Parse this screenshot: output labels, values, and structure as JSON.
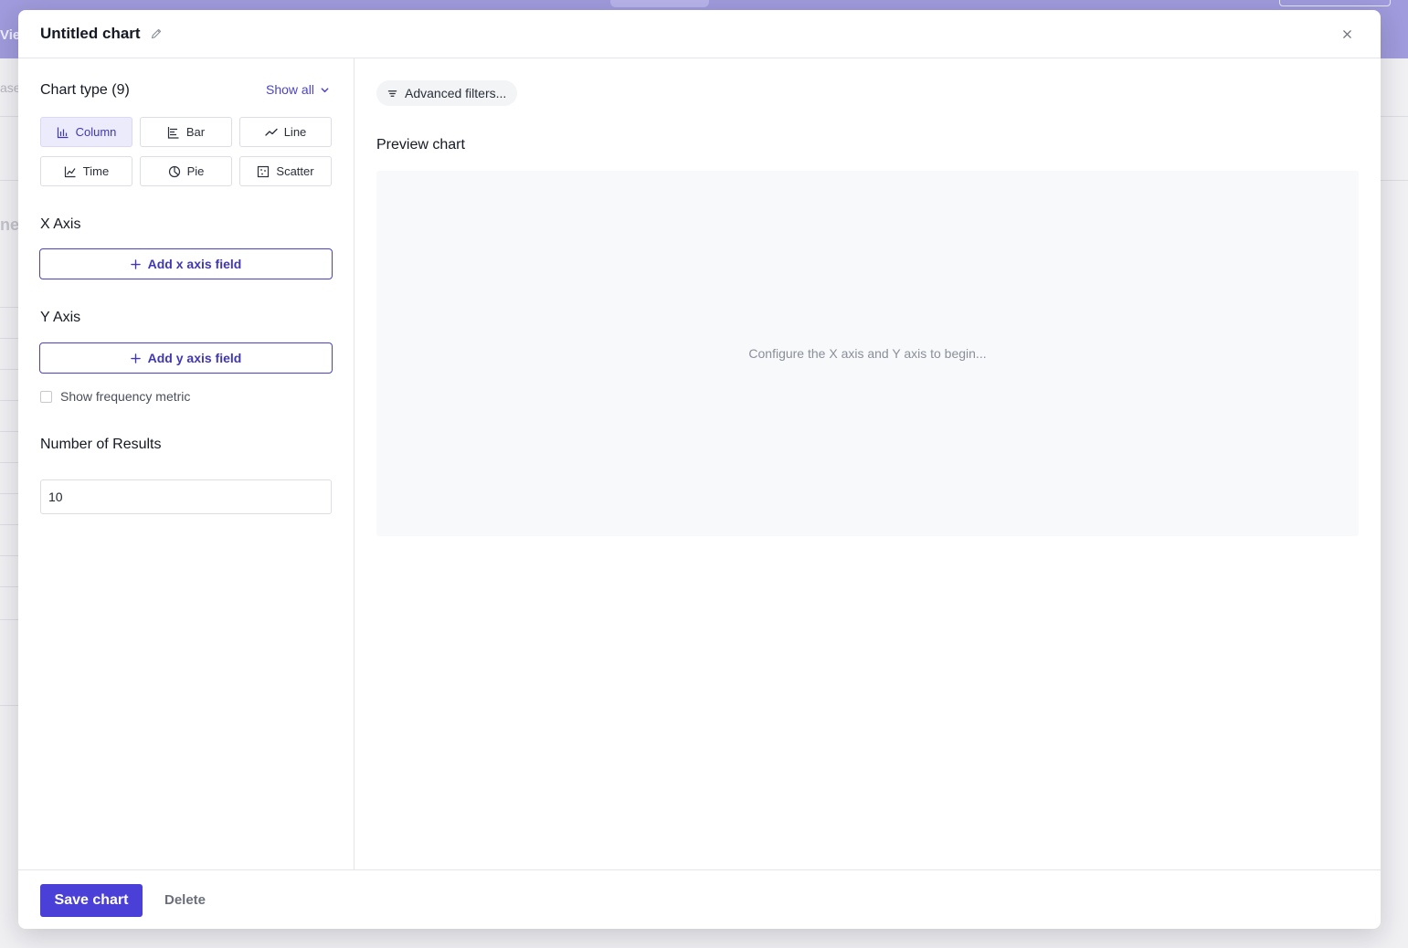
{
  "background": {
    "view_label": "Vie",
    "faded_text_1": "ase",
    "faded_text_2": "ne"
  },
  "modal": {
    "title": "Untitled chart",
    "icons": {
      "edit": "pencil-icon",
      "close": "close-icon"
    }
  },
  "sidebar": {
    "chart_type_label": "Chart type (9)",
    "show_all_label": "Show all",
    "chart_types": [
      {
        "label": "Column",
        "icon": "column-chart-icon",
        "active": true
      },
      {
        "label": "Bar",
        "icon": "bar-chart-icon",
        "active": false
      },
      {
        "label": "Line",
        "icon": "line-chart-icon",
        "active": false
      },
      {
        "label": "Time",
        "icon": "time-chart-icon",
        "active": false
      },
      {
        "label": "Pie",
        "icon": "pie-chart-icon",
        "active": false
      },
      {
        "label": "Scatter",
        "icon": "scatter-chart-icon",
        "active": false
      }
    ],
    "x_axis_label": "X Axis",
    "add_x_label": "Add x axis field",
    "y_axis_label": "Y Axis",
    "add_y_label": "Add y axis field",
    "frequency_label": "Show frequency metric",
    "frequency_checked": false,
    "results_label": "Number of Results",
    "results_value": "10"
  },
  "main": {
    "advanced_filters_label": "Advanced filters...",
    "preview_title": "Preview chart",
    "preview_empty": "Configure the X axis and Y axis to begin..."
  },
  "footer": {
    "save_label": "Save chart",
    "delete_label": "Delete"
  },
  "colors": {
    "accent": "#4a3fd6",
    "accent_text": "#3f37b5",
    "active_bg": "#ecebfb",
    "topbar": "#9f9bdc"
  }
}
